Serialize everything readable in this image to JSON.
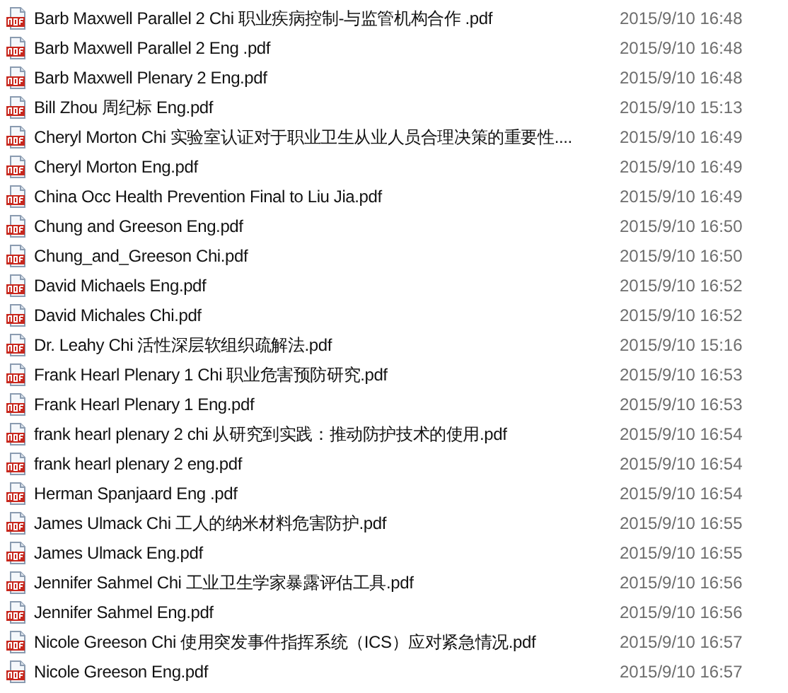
{
  "files": [
    {
      "name": "Barb Maxwell Parallel 2 Chi 职业疾病控制-与监管机构合作 .pdf",
      "modified": "2015/9/10 16:48"
    },
    {
      "name": "Barb Maxwell Parallel 2 Eng .pdf",
      "modified": "2015/9/10 16:48"
    },
    {
      "name": "Barb Maxwell Plenary 2 Eng.pdf",
      "modified": "2015/9/10 16:48"
    },
    {
      "name": "Bill Zhou 周纪标  Eng.pdf",
      "modified": "2015/9/10 15:13"
    },
    {
      "name": "Cheryl Morton Chi 实验室认证对于职业卫生从业人员合理决策的重要性....",
      "modified": "2015/9/10 16:49"
    },
    {
      "name": "Cheryl Morton Eng.pdf",
      "modified": "2015/9/10 16:49"
    },
    {
      "name": "China Occ Health Prevention Final to Liu Jia.pdf",
      "modified": "2015/9/10 16:49"
    },
    {
      "name": "Chung and Greeson Eng.pdf",
      "modified": "2015/9/10 16:50"
    },
    {
      "name": "Chung_and_Greeson Chi.pdf",
      "modified": "2015/9/10 16:50"
    },
    {
      "name": "David Michaels Eng.pdf",
      "modified": "2015/9/10 16:52"
    },
    {
      "name": "David Michales Chi.pdf",
      "modified": "2015/9/10 16:52"
    },
    {
      "name": "Dr. Leahy Chi 活性深层软组织疏解法.pdf",
      "modified": "2015/9/10 15:16"
    },
    {
      "name": "Frank Hearl Plenary 1 Chi 职业危害预防研究.pdf",
      "modified": "2015/9/10 16:53"
    },
    {
      "name": "Frank Hearl Plenary 1 Eng.pdf",
      "modified": "2015/9/10 16:53"
    },
    {
      "name": "frank hearl plenary 2 chi 从研究到实践：推动防护技术的使用.pdf",
      "modified": "2015/9/10 16:54"
    },
    {
      "name": "frank hearl plenary 2 eng.pdf",
      "modified": "2015/9/10 16:54"
    },
    {
      "name": "Herman Spanjaard Eng .pdf",
      "modified": "2015/9/10 16:54"
    },
    {
      "name": "James Ulmack Chi 工人的纳米材料危害防护.pdf",
      "modified": "2015/9/10 16:55"
    },
    {
      "name": "James Ulmack Eng.pdf",
      "modified": "2015/9/10 16:55"
    },
    {
      "name": "Jennifer Sahmel Chi 工业卫生学家暴露评估工具.pdf",
      "modified": "2015/9/10 16:56"
    },
    {
      "name": "Jennifer Sahmel Eng.pdf",
      "modified": "2015/9/10 16:56"
    },
    {
      "name": "Nicole Greeson Chi 使用突发事件指挥系统（ICS）应对紧急情况.pdf",
      "modified": "2015/9/10 16:57"
    },
    {
      "name": "Nicole Greeson Eng.pdf",
      "modified": "2015/9/10 16:57"
    }
  ]
}
